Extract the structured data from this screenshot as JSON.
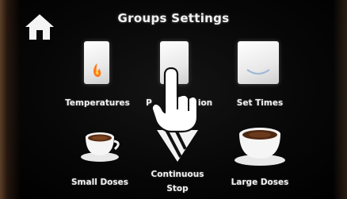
{
  "header": {
    "title": "Groups Settings"
  },
  "tiles": [
    {
      "label": "Temperatures",
      "icon": "temperature-flame-icon"
    },
    {
      "label": "Pre-infusion",
      "icon": "pre-infusion-icon"
    },
    {
      "label": "Set Times",
      "icon": "set-times-icon"
    },
    {
      "label": "Small Doses",
      "icon": "small-cup-icon"
    },
    {
      "label": "Continuous Stop",
      "icon": "continuous-stop-icon"
    },
    {
      "label": "Large Doses",
      "icon": "large-cup-icon"
    }
  ],
  "visible_labels": {
    "temperatures": "Temperatures",
    "pre_infusion_fragment_left": "P",
    "pre_infusion_fragment_right": "ion",
    "set_times": "Set Times",
    "small_doses": "Small Doses",
    "continuous_line1": "Continuous",
    "continuous_line2": "Stop",
    "large_doses": "Large Doses"
  },
  "colors": {
    "background": "#000000",
    "text": "#f0f0f0",
    "flame": "#ff7a1a",
    "panel": "#f2f2f2"
  }
}
